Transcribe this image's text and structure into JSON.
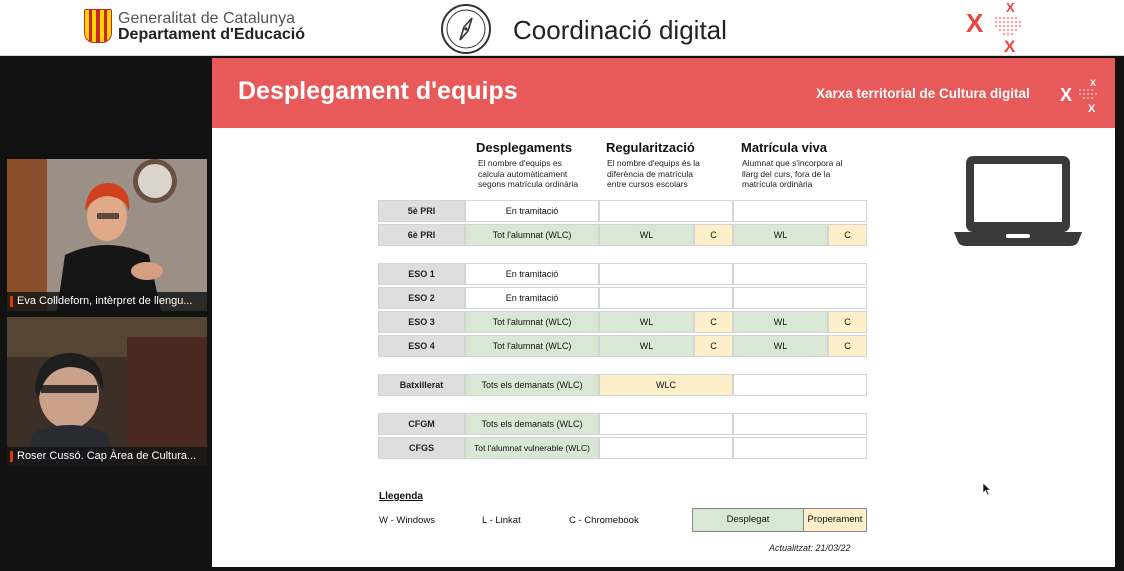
{
  "banner": {
    "org_line1": "Generalitat de Catalunya",
    "org_line2": "Departament d'Educació",
    "title": "Coordinació digital",
    "logo_icon": "generalitat-flag-icon",
    "compass_icon": "compass-icon",
    "brand_icon": "xarxa-x-logo-icon"
  },
  "participants": [
    {
      "name": "Eva Colldeforn, intèrpret de llengu..."
    },
    {
      "name": "Roser Cussó. Cap Àrea de Cultura..."
    }
  ],
  "slide": {
    "title": "Desplegament d'equips",
    "subtitle": "Xarxa territorial de Cultura digital",
    "columns": [
      {
        "title": "Desplegaments",
        "desc": [
          "El nombre d'equips es",
          "calcula automàticament",
          "segons matrícula ordinària"
        ]
      },
      {
        "title": "Regularització",
        "desc": [
          "El nombre d'equips és la",
          "diferència de matrícula",
          "entre cursos escolars"
        ]
      },
      {
        "title": "Matrícula viva",
        "desc": [
          "Alumnat que s'incorpora al",
          "llarg del curs, fora de la",
          "matrícula ordinària"
        ]
      }
    ],
    "rows": [
      {
        "label": "5è PRI",
        "deploy": "En tramitació",
        "reg": "",
        "reg_c": "",
        "viva": "",
        "viva_c": ""
      },
      {
        "label": "6è PRI",
        "deploy": "Tot l'alumnat (WLC)",
        "reg": "WL",
        "reg_c": "C",
        "viva": "WL",
        "viva_c": "C"
      },
      {
        "label": "ESO 1",
        "deploy": "En tramitació",
        "reg": "",
        "reg_c": "",
        "viva": "",
        "viva_c": ""
      },
      {
        "label": "ESO 2",
        "deploy": "En tramitació",
        "reg": "",
        "reg_c": "",
        "viva": "",
        "viva_c": ""
      },
      {
        "label": "ESO 3",
        "deploy": "Tot l'alumnat (WLC)",
        "reg": "WL",
        "reg_c": "C",
        "viva": "WL",
        "viva_c": "C"
      },
      {
        "label": "ESO 4",
        "deploy": "Tot l'alumnat (WLC)",
        "reg": "WL",
        "reg_c": "C",
        "viva": "WL",
        "viva_c": "C"
      },
      {
        "label": "Batxillerat",
        "deploy": "Tots els demanats (WLC)",
        "reg": "WLC",
        "viva": ""
      },
      {
        "label": "CFGM",
        "deploy": "Tots els demanats (WLC)",
        "reg": "",
        "viva": ""
      },
      {
        "label": "CFGS",
        "deploy": "Tot l'alumnat vulnerable (WLC)",
        "reg": "",
        "viva": ""
      }
    ],
    "legend": {
      "title": "Llegenda",
      "items": [
        "W - Windows",
        "L - Linkat",
        "C - Chromebook"
      ],
      "deployed": "Desplegat",
      "next": "Properament"
    },
    "updated": "Actualitzat: 21/03/22",
    "device_icon": "laptop-icon"
  },
  "colors": {
    "header_red": "#e85a5a",
    "deployed_green": "#d9e8d4",
    "upcoming_yellow": "#fcefc9",
    "label_gray": "#dedede"
  }
}
